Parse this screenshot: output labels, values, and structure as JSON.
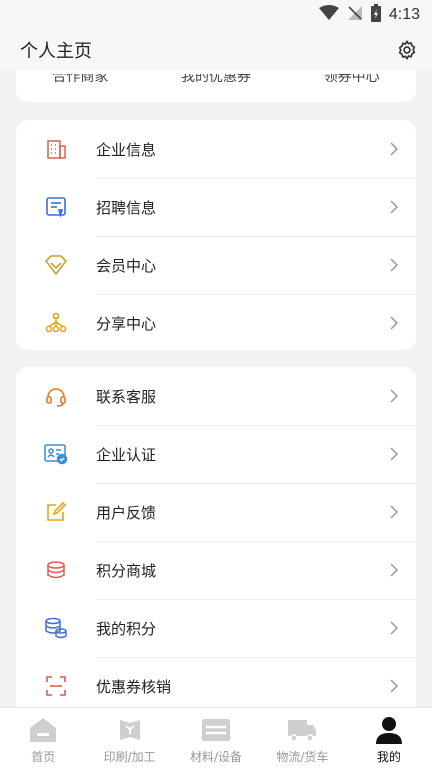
{
  "status_bar": {
    "time": "4:13"
  },
  "header": {
    "title": "个人主页"
  },
  "top_card": {
    "links": [
      "合作商家",
      "我的优惠券",
      "领券中心"
    ]
  },
  "group_a": {
    "items": [
      {
        "label": "企业信息",
        "icon": "building-icon",
        "color": "#e05a4f"
      },
      {
        "label": "招聘信息",
        "icon": "job-post-icon",
        "color": "#3b6fd6"
      },
      {
        "label": "会员中心",
        "icon": "diamond-icon",
        "color": "#c9a12b"
      },
      {
        "label": "分享中心",
        "icon": "share-icon",
        "color": "#e8a317"
      }
    ]
  },
  "group_b": {
    "items": [
      {
        "label": "联系客服",
        "icon": "headset-icon",
        "color": "#e07b2a"
      },
      {
        "label": "企业认证",
        "icon": "id-card-icon",
        "color": "#3a8fd8"
      },
      {
        "label": "用户反馈",
        "icon": "feedback-icon",
        "color": "#e8a317"
      },
      {
        "label": "积分商城",
        "icon": "coins-stack-icon",
        "color": "#e05a4f"
      },
      {
        "label": "我的积分",
        "icon": "points-icon",
        "color": "#3b6fd6"
      },
      {
        "label": "优惠券核销",
        "icon": "scan-icon",
        "color": "#e05a4f"
      }
    ]
  },
  "tabbar": {
    "tabs": [
      {
        "label": "首页",
        "icon": "home-icon",
        "active": false
      },
      {
        "label": "印刷/加工",
        "icon": "print-icon",
        "active": false
      },
      {
        "label": "材料/设备",
        "icon": "materials-icon",
        "active": false
      },
      {
        "label": "物流/货车",
        "icon": "truck-icon",
        "active": false
      },
      {
        "label": "我的",
        "icon": "profile-icon",
        "active": true
      }
    ]
  }
}
